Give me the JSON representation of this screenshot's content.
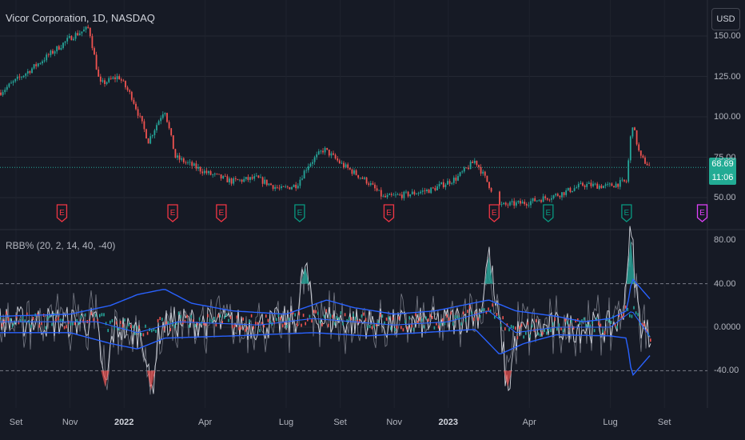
{
  "header": {
    "symbol_title": "Vicor Corporation, 1D, NASDAQ",
    "currency_button": "USD"
  },
  "price_tag": {
    "price": "68.69",
    "countdown": "11:06",
    "color": "#22ab94"
  },
  "indicator": {
    "title": "RBB% (20, 2, 14, 40, -40)",
    "upper_level": 40,
    "lower_level": -40
  },
  "colors": {
    "up": "#26a69a",
    "down": "#ef5350",
    "band": "#2962ff",
    "bg": "#161a25",
    "earn_red": "#f23645",
    "earn_green": "#089981",
    "earn_future": "#e040fb"
  },
  "chart_data": [
    {
      "type": "candlestick",
      "title": "Vicor Corporation, 1D, NASDAQ",
      "y_ticks": [
        "150.00",
        "125.00",
        "100.00",
        "75.00",
        "50.00"
      ],
      "ylim": [
        40,
        160
      ],
      "x_ticks": [
        {
          "label": "Set",
          "m": 0
        },
        {
          "label": "Nov",
          "m": 2
        },
        {
          "label": "2022",
          "m": 4,
          "bold": true
        },
        {
          "label": "Apr",
          "m": 7
        },
        {
          "label": "Lug",
          "m": 10
        },
        {
          "label": "Set",
          "m": 12
        },
        {
          "label": "Nov",
          "m": 14
        },
        {
          "label": "2023",
          "m": 16,
          "bold": true
        },
        {
          "label": "Apr",
          "m": 19
        },
        {
          "label": "Lug",
          "m": 22
        },
        {
          "label": "Set",
          "m": 24
        }
      ],
      "close_points_month_value": [
        [
          -0.6,
          115
        ],
        [
          0.6,
          130
        ],
        [
          1.2,
          138
        ],
        [
          2.1,
          150
        ],
        [
          2.7,
          155
        ],
        [
          3.1,
          120
        ],
        [
          3.8,
          125
        ],
        [
          4.3,
          112
        ],
        [
          4.9,
          85
        ],
        [
          5.5,
          105
        ],
        [
          5.9,
          75
        ],
        [
          6.5,
          70
        ],
        [
          7.1,
          65
        ],
        [
          8.0,
          60
        ],
        [
          8.9,
          62
        ],
        [
          9.8,
          55
        ],
        [
          10.4,
          58
        ],
        [
          10.8,
          70
        ],
        [
          11.4,
          80
        ],
        [
          12.1,
          70
        ],
        [
          13.0,
          60
        ],
        [
          13.6,
          50
        ],
        [
          14.5,
          52
        ],
        [
          15.4,
          55
        ],
        [
          16.3,
          62
        ],
        [
          17.0,
          73
        ],
        [
          17.6,
          55
        ],
        [
          17.9,
          45
        ],
        [
          18.9,
          47
        ],
        [
          20.1,
          52
        ],
        [
          21.0,
          58
        ],
        [
          21.9,
          57
        ],
        [
          22.6,
          60
        ],
        [
          22.8,
          97
        ],
        [
          23.1,
          75
        ],
        [
          23.5,
          68.69
        ]
      ],
      "last_price": 68.69,
      "earnings_markers": [
        {
          "m": 1.7,
          "label": "E",
          "result": "miss"
        },
        {
          "m": 5.8,
          "label": "E",
          "result": "miss"
        },
        {
          "m": 7.6,
          "label": "E",
          "result": "miss"
        },
        {
          "m": 10.5,
          "label": "E",
          "result": "beat"
        },
        {
          "m": 13.8,
          "label": "E",
          "result": "miss"
        },
        {
          "m": 17.7,
          "label": "E",
          "result": "miss"
        },
        {
          "m": 19.7,
          "label": "E",
          "result": "beat"
        },
        {
          "m": 22.6,
          "label": "E",
          "result": "beat"
        },
        {
          "m": 25.4,
          "label": "E",
          "result": "upcoming"
        }
      ]
    },
    {
      "type": "line",
      "title": "RBB% (20, 2, 14, 40, -40)",
      "y_ticks": [
        "80.00",
        "40.00",
        "0.0000",
        "-40.00"
      ],
      "ylim": [
        -70,
        88
      ],
      "upper_band": [
        [
          -0.6,
          10
        ],
        [
          2,
          12
        ],
        [
          3.5,
          20
        ],
        [
          4.5,
          30
        ],
        [
          5.5,
          35
        ],
        [
          6.5,
          22
        ],
        [
          8,
          15
        ],
        [
          10,
          12
        ],
        [
          11.5,
          25
        ],
        [
          12.5,
          18
        ],
        [
          14,
          12
        ],
        [
          15.5,
          15
        ],
        [
          16.5,
          20
        ],
        [
          17.5,
          25
        ],
        [
          18.5,
          15
        ],
        [
          20,
          10
        ],
        [
          21,
          5
        ],
        [
          22,
          8
        ],
        [
          22.6,
          15
        ],
        [
          22.8,
          45
        ],
        [
          23.5,
          25
        ]
      ],
      "middle": [
        [
          -0.6,
          5
        ],
        [
          3,
          5
        ],
        [
          4.5,
          -5
        ],
        [
          6,
          5
        ],
        [
          9,
          2
        ],
        [
          11,
          8
        ],
        [
          14,
          2
        ],
        [
          16,
          5
        ],
        [
          17.5,
          15
        ],
        [
          18.5,
          -5
        ],
        [
          20,
          0
        ],
        [
          22,
          0
        ],
        [
          22.8,
          15
        ],
        [
          23.5,
          -10
        ]
      ],
      "lower_band": [
        [
          -0.6,
          -5
        ],
        [
          2,
          -5
        ],
        [
          3.5,
          -15
        ],
        [
          4.5,
          -20
        ],
        [
          5.5,
          -10
        ],
        [
          8,
          -8
        ],
        [
          11,
          -5
        ],
        [
          13,
          -8
        ],
        [
          15,
          -5
        ],
        [
          17,
          -2
        ],
        [
          17.9,
          -25
        ],
        [
          18.8,
          -15
        ],
        [
          20,
          -7
        ],
        [
          22,
          -8
        ],
        [
          22.6,
          -10
        ],
        [
          22.8,
          -45
        ],
        [
          23.5,
          -25
        ]
      ],
      "highlights": [
        {
          "m": 10.7,
          "value": 55
        },
        {
          "m": 17.5,
          "value": 65
        },
        {
          "m": 22.75,
          "value": 82
        },
        {
          "m": 3.3,
          "value": -55
        },
        {
          "m": 5,
          "value": -58
        },
        {
          "m": 18.2,
          "value": -55
        }
      ]
    }
  ]
}
